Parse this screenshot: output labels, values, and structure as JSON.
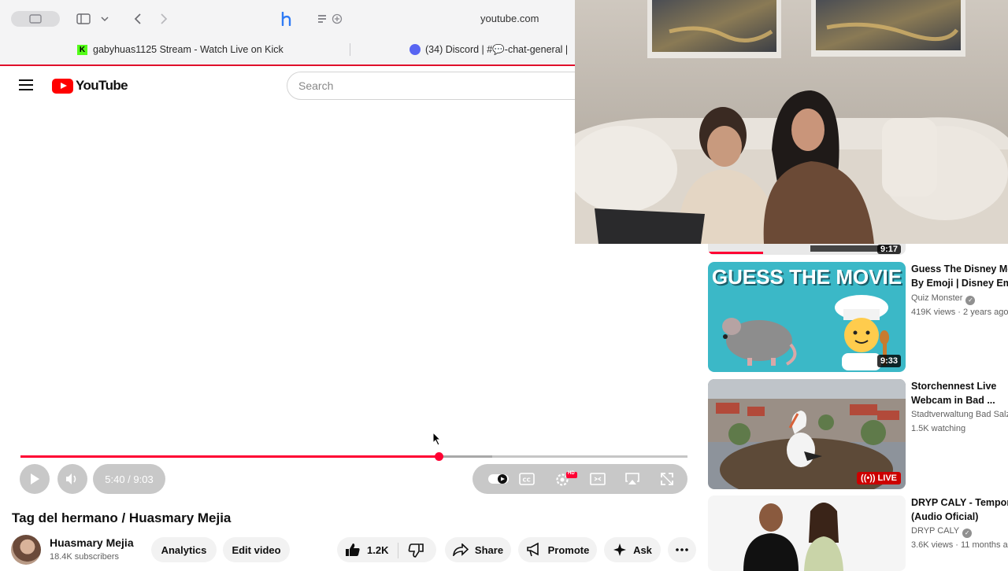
{
  "browser": {
    "url": "youtube.com",
    "tabs": [
      {
        "label": "gabyhuas1125 Stream - Watch Live on Kick"
      },
      {
        "label": "(34) Discord | #💬-chat-general |"
      }
    ]
  },
  "youtube": {
    "logo_text": "YouTube",
    "search_placeholder": "Search"
  },
  "player": {
    "time_display": "5:40 / 9:03",
    "progress_fraction": 0.627,
    "buffered_fraction": 0.707,
    "settings_badge": "HD"
  },
  "video": {
    "title": "Tag del hermano / Huasmary Mejia",
    "channel_name": "Huasmary Mejia",
    "subscribers": "18.4K subscribers",
    "analytics_label": "Analytics",
    "edit_label": "Edit video",
    "like_count": "1.2K",
    "share_label": "Share",
    "promote_label": "Promote",
    "ask_label": "Ask"
  },
  "recommendations": {
    "partial_duration": "9:17",
    "items": [
      {
        "title_line1": "Guess The Disney Mo",
        "title_line2": "By Emoji | Disney Em",
        "channel": "Quiz Monster",
        "meta": "419K views · 2 years ago",
        "duration": "9:33",
        "thumb_text": "GUESS THE MOVIE"
      },
      {
        "title_line1": "Storchennest Live",
        "title_line2": "Webcam in Bad ...",
        "channel": "Stadtverwaltung Bad Salz",
        "meta": "1.5K watching",
        "badge": "LIVE"
      },
      {
        "title_line1": "DRYP CALY - Tempora",
        "title_line2": "(Audio Oficial)",
        "channel": "DRYP CALY",
        "meta": "3.6K views · 11 months a"
      }
    ]
  }
}
